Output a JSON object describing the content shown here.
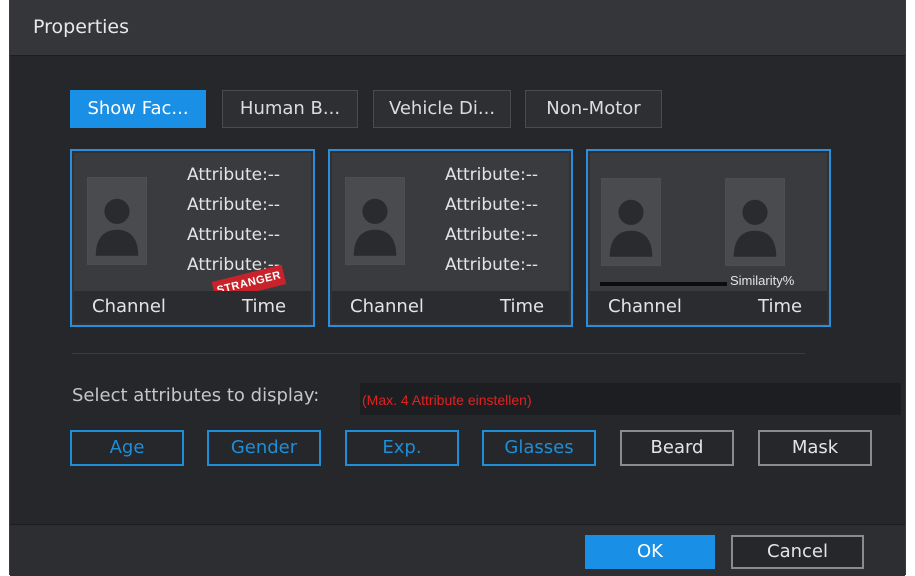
{
  "dialog": {
    "title": "Properties"
  },
  "tabs": [
    {
      "label": "Show Fac...",
      "active": true
    },
    {
      "label": "Human B...",
      "active": false
    },
    {
      "label": "Vehicle Di...",
      "active": false
    },
    {
      "label": "Non-Motor",
      "active": false
    }
  ],
  "previews": {
    "card1": {
      "attributes": [
        "Attribute:--",
        "Attribute:--",
        "Attribute:--",
        "Attribute:--"
      ],
      "stamp": "STRANGER",
      "channel": "Channel",
      "time": "Time"
    },
    "card2": {
      "attributes": [
        "Attribute:--",
        "Attribute:--",
        "Attribute:--",
        "Attribute:--"
      ],
      "channel": "Channel",
      "time": "Time"
    },
    "card3": {
      "similarity": "Similarity%",
      "channel": "Channel",
      "time": "Time"
    }
  },
  "attribute_select": {
    "label": "Select attributes to display:",
    "hint": "(Max. 4 Attribute einstellen)",
    "options": [
      {
        "label": "Age",
        "selected": true
      },
      {
        "label": "Gender",
        "selected": true
      },
      {
        "label": "Exp.",
        "selected": true
      },
      {
        "label": "Glasses",
        "selected": true
      },
      {
        "label": "Beard",
        "selected": false
      },
      {
        "label": "Mask",
        "selected": false
      }
    ]
  },
  "buttons": {
    "ok": "OK",
    "cancel": "Cancel"
  },
  "colors": {
    "accent": "#1a8fe6",
    "panel": "#26272a",
    "hint": "#e02222",
    "stamp": "#c8222a"
  },
  "icons": {
    "face_placeholder": "person-silhouette-icon"
  }
}
